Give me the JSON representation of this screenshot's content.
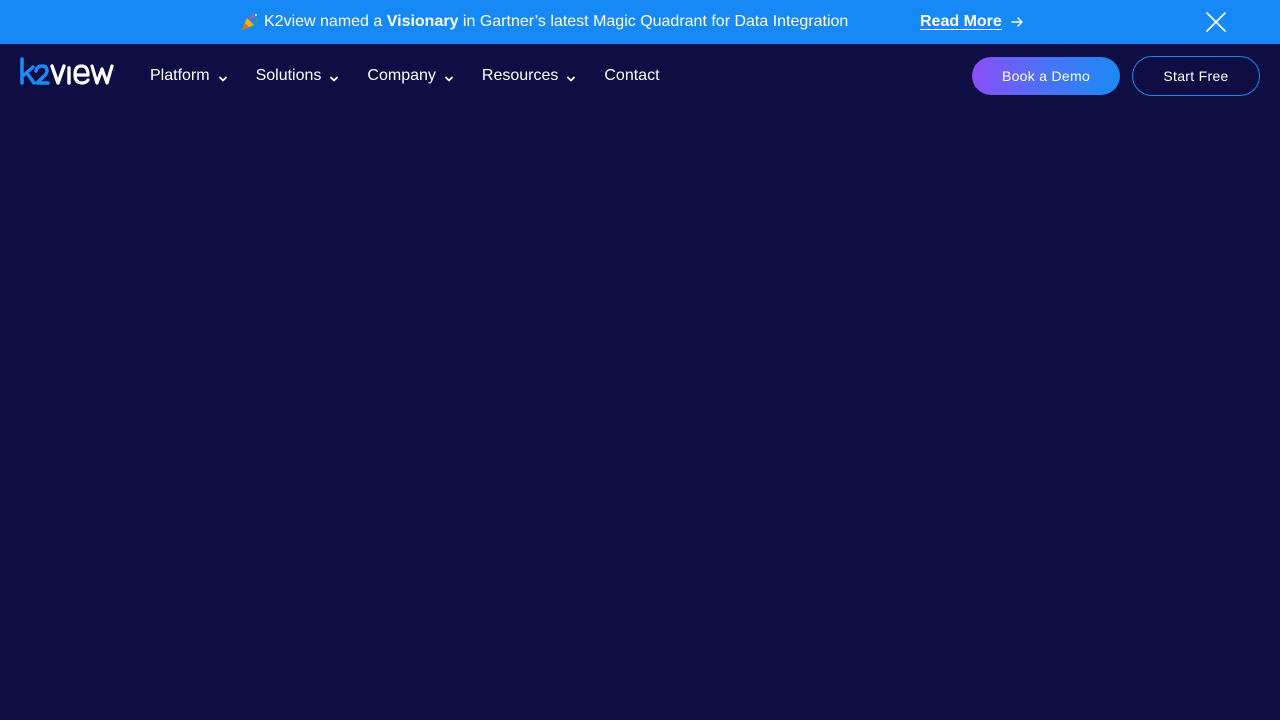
{
  "announcement": {
    "text_before": "K2view named a ",
    "text_bold": "Visionary",
    "text_after": " in Gartner’s latest Magic Quadrant for Data Integration",
    "link_label": "Read More",
    "icon": "party-popper-icon",
    "background_color": "#1689f6"
  },
  "header": {
    "logo_text": "k2view",
    "nav": [
      {
        "label": "Platform",
        "has_dropdown": true
      },
      {
        "label": "Solutions",
        "has_dropdown": true
      },
      {
        "label": "Company",
        "has_dropdown": true
      },
      {
        "label": "Resources",
        "has_dropdown": true
      },
      {
        "label": "Contact",
        "has_dropdown": false
      }
    ],
    "cta_primary": "Book a Demo",
    "cta_secondary": "Start Free",
    "background_color": "#0e0d44"
  }
}
